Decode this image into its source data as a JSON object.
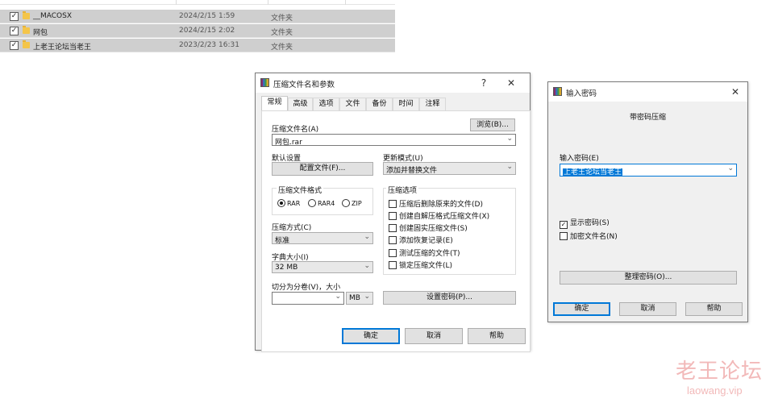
{
  "explorer": {
    "rows": [
      {
        "name": "__MACOSX",
        "date": "2024/2/15 1:59",
        "type": "文件夹",
        "checked": true
      },
      {
        "name": "网包",
        "date": "2024/2/15 2:02",
        "type": "文件夹",
        "checked": true
      },
      {
        "name": "上老王论坛当老王",
        "date": "2023/2/23 16:31",
        "type": "文件夹",
        "checked": true
      }
    ]
  },
  "archive_dialog": {
    "title": "压缩文件名和参数",
    "help_btn": "?",
    "close_btn": "✕",
    "tabs": [
      "常规",
      "高级",
      "选项",
      "文件",
      "备份",
      "时间",
      "注释"
    ],
    "archive_name_label": "压缩文件名(A)",
    "browse_btn": "浏览(B)...",
    "archive_name_value": "网包.rar",
    "default_settings_label": "默认设置",
    "profiles_btn": "配置文件(F)...",
    "update_mode_label": "更新模式(U)",
    "update_mode_value": "添加并替换文件",
    "format_group_label": "压缩文件格式",
    "formats": [
      "RAR",
      "RAR4",
      "ZIP"
    ],
    "format_selected": "RAR",
    "options_group_label": "压缩选项",
    "options": [
      {
        "label": "压缩后删除原来的文件(D)",
        "checked": false
      },
      {
        "label": "创建自解压格式压缩文件(X)",
        "checked": false
      },
      {
        "label": "创建固实压缩文件(S)",
        "checked": false
      },
      {
        "label": "添加恢复记录(E)",
        "checked": false
      },
      {
        "label": "测试压缩的文件(T)",
        "checked": false
      },
      {
        "label": "锁定压缩文件(L)",
        "checked": false
      }
    ],
    "method_label": "压缩方式(C)",
    "method_value": "标准",
    "dict_label": "字典大小(I)",
    "dict_value": "32 MB",
    "split_label": "切分为分卷(V)，大小",
    "split_value": "",
    "split_unit": "MB",
    "set_password_btn": "设置密码(P)...",
    "ok_btn": "确定",
    "cancel_btn": "取消",
    "help_bottom_btn": "帮助"
  },
  "password_dialog": {
    "title": "输入密码",
    "close_btn": "✕",
    "header": "带密码压缩",
    "enter_password_label": "输入密码(E)",
    "password_value": "上老王论坛当老王",
    "show_password_label": "显示密码(S)",
    "show_password_checked": true,
    "encrypt_names_label": "加密文件名(N)",
    "encrypt_names_checked": false,
    "organize_btn": "整理密码(O)...",
    "ok_btn": "确定",
    "cancel_btn": "取消",
    "help_btn": "帮助"
  },
  "watermark": {
    "cn": "老王论坛",
    "en": "laowang.vip"
  }
}
